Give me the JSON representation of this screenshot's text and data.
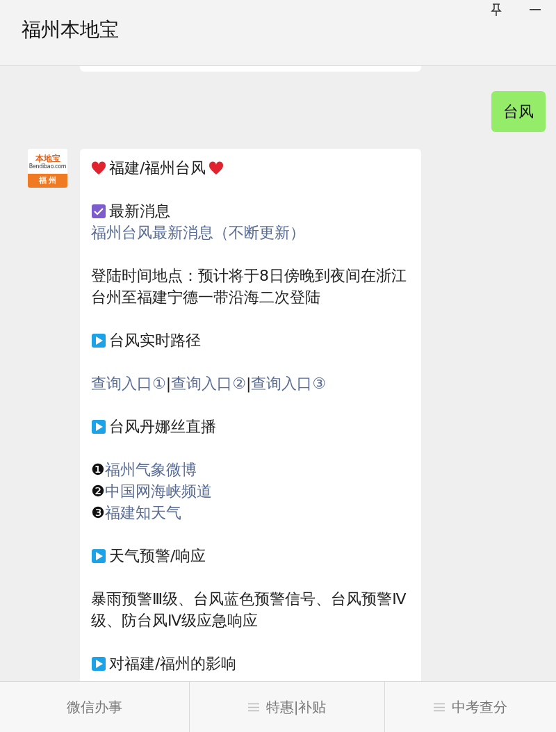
{
  "header": {
    "title": "福州本地宝",
    "controls": [
      {
        "kind": "pin"
      },
      {
        "kind": "minimize"
      }
    ]
  },
  "user_message": {
    "text": "台风"
  },
  "article": {
    "avatar": {
      "logo_text": "本地宝",
      "site_text": "Bendibao.com",
      "city": "福 州"
    },
    "paragraphs": [
      [
        {
          "kind": "hearts",
          "text": "福建/福州台风"
        }
      ],
      [
        {
          "kind": "checked",
          "text": "最新消息"
        },
        {
          "kind": "link",
          "text": "福州台风最新消息（不断更新）"
        }
      ],
      [
        {
          "kind": "text",
          "text": "登陆时间地点：预计将于8日傍晚到夜间在浙江台州至福建宁德一带沿海二次登陆"
        }
      ],
      [
        {
          "kind": "play",
          "text": "台风实时路径"
        }
      ],
      [
        {
          "kind": "links",
          "separator": "|",
          "items": [
            "查询入口①",
            "查询入口②",
            "查询入口③"
          ]
        }
      ],
      [
        {
          "kind": "play",
          "text": "台风丹娜丝直播"
        }
      ],
      [
        {
          "kind": "numbered",
          "number": "❶",
          "text": "福州气象微博"
        },
        {
          "kind": "numbered",
          "number": "❷",
          "text": "中国网海峡频道"
        },
        {
          "kind": "numbered",
          "number": "❸",
          "text": "福建知天气"
        }
      ],
      [
        {
          "kind": "play",
          "text": "天气预警/响应"
        }
      ],
      [
        {
          "kind": "text",
          "text": "暴雨预警Ⅲ级、台风蓝色预警信号、台风预警Ⅳ级、防台风Ⅳ级应急响应"
        }
      ],
      [
        {
          "kind": "play",
          "text": "对福建/福州的影响"
        }
      ]
    ]
  },
  "footer": [
    {
      "label": "微信办事",
      "has_menu": false
    },
    {
      "label": "特惠|补贴",
      "has_menu": true
    },
    {
      "label": "中考查分",
      "has_menu": true
    }
  ]
}
